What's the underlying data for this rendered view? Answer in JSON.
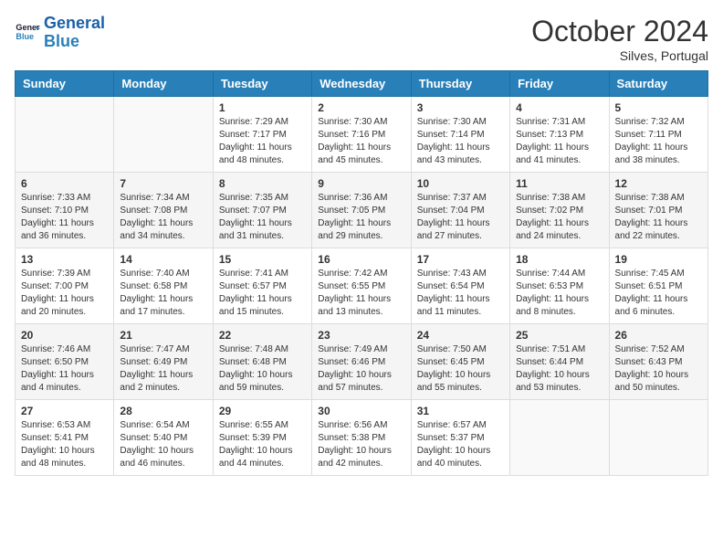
{
  "logo": {
    "line1": "General",
    "line2": "Blue"
  },
  "title": "October 2024",
  "location": "Silves, Portugal",
  "days_header": [
    "Sunday",
    "Monday",
    "Tuesday",
    "Wednesday",
    "Thursday",
    "Friday",
    "Saturday"
  ],
  "weeks": [
    [
      {
        "num": "",
        "info": ""
      },
      {
        "num": "",
        "info": ""
      },
      {
        "num": "1",
        "info": "Sunrise: 7:29 AM\nSunset: 7:17 PM\nDaylight: 11 hours and 48 minutes."
      },
      {
        "num": "2",
        "info": "Sunrise: 7:30 AM\nSunset: 7:16 PM\nDaylight: 11 hours and 45 minutes."
      },
      {
        "num": "3",
        "info": "Sunrise: 7:30 AM\nSunset: 7:14 PM\nDaylight: 11 hours and 43 minutes."
      },
      {
        "num": "4",
        "info": "Sunrise: 7:31 AM\nSunset: 7:13 PM\nDaylight: 11 hours and 41 minutes."
      },
      {
        "num": "5",
        "info": "Sunrise: 7:32 AM\nSunset: 7:11 PM\nDaylight: 11 hours and 38 minutes."
      }
    ],
    [
      {
        "num": "6",
        "info": "Sunrise: 7:33 AM\nSunset: 7:10 PM\nDaylight: 11 hours and 36 minutes."
      },
      {
        "num": "7",
        "info": "Sunrise: 7:34 AM\nSunset: 7:08 PM\nDaylight: 11 hours and 34 minutes."
      },
      {
        "num": "8",
        "info": "Sunrise: 7:35 AM\nSunset: 7:07 PM\nDaylight: 11 hours and 31 minutes."
      },
      {
        "num": "9",
        "info": "Sunrise: 7:36 AM\nSunset: 7:05 PM\nDaylight: 11 hours and 29 minutes."
      },
      {
        "num": "10",
        "info": "Sunrise: 7:37 AM\nSunset: 7:04 PM\nDaylight: 11 hours and 27 minutes."
      },
      {
        "num": "11",
        "info": "Sunrise: 7:38 AM\nSunset: 7:02 PM\nDaylight: 11 hours and 24 minutes."
      },
      {
        "num": "12",
        "info": "Sunrise: 7:38 AM\nSunset: 7:01 PM\nDaylight: 11 hours and 22 minutes."
      }
    ],
    [
      {
        "num": "13",
        "info": "Sunrise: 7:39 AM\nSunset: 7:00 PM\nDaylight: 11 hours and 20 minutes."
      },
      {
        "num": "14",
        "info": "Sunrise: 7:40 AM\nSunset: 6:58 PM\nDaylight: 11 hours and 17 minutes."
      },
      {
        "num": "15",
        "info": "Sunrise: 7:41 AM\nSunset: 6:57 PM\nDaylight: 11 hours and 15 minutes."
      },
      {
        "num": "16",
        "info": "Sunrise: 7:42 AM\nSunset: 6:55 PM\nDaylight: 11 hours and 13 minutes."
      },
      {
        "num": "17",
        "info": "Sunrise: 7:43 AM\nSunset: 6:54 PM\nDaylight: 11 hours and 11 minutes."
      },
      {
        "num": "18",
        "info": "Sunrise: 7:44 AM\nSunset: 6:53 PM\nDaylight: 11 hours and 8 minutes."
      },
      {
        "num": "19",
        "info": "Sunrise: 7:45 AM\nSunset: 6:51 PM\nDaylight: 11 hours and 6 minutes."
      }
    ],
    [
      {
        "num": "20",
        "info": "Sunrise: 7:46 AM\nSunset: 6:50 PM\nDaylight: 11 hours and 4 minutes."
      },
      {
        "num": "21",
        "info": "Sunrise: 7:47 AM\nSunset: 6:49 PM\nDaylight: 11 hours and 2 minutes."
      },
      {
        "num": "22",
        "info": "Sunrise: 7:48 AM\nSunset: 6:48 PM\nDaylight: 10 hours and 59 minutes."
      },
      {
        "num": "23",
        "info": "Sunrise: 7:49 AM\nSunset: 6:46 PM\nDaylight: 10 hours and 57 minutes."
      },
      {
        "num": "24",
        "info": "Sunrise: 7:50 AM\nSunset: 6:45 PM\nDaylight: 10 hours and 55 minutes."
      },
      {
        "num": "25",
        "info": "Sunrise: 7:51 AM\nSunset: 6:44 PM\nDaylight: 10 hours and 53 minutes."
      },
      {
        "num": "26",
        "info": "Sunrise: 7:52 AM\nSunset: 6:43 PM\nDaylight: 10 hours and 50 minutes."
      }
    ],
    [
      {
        "num": "27",
        "info": "Sunrise: 6:53 AM\nSunset: 5:41 PM\nDaylight: 10 hours and 48 minutes."
      },
      {
        "num": "28",
        "info": "Sunrise: 6:54 AM\nSunset: 5:40 PM\nDaylight: 10 hours and 46 minutes."
      },
      {
        "num": "29",
        "info": "Sunrise: 6:55 AM\nSunset: 5:39 PM\nDaylight: 10 hours and 44 minutes."
      },
      {
        "num": "30",
        "info": "Sunrise: 6:56 AM\nSunset: 5:38 PM\nDaylight: 10 hours and 42 minutes."
      },
      {
        "num": "31",
        "info": "Sunrise: 6:57 AM\nSunset: 5:37 PM\nDaylight: 10 hours and 40 minutes."
      },
      {
        "num": "",
        "info": ""
      },
      {
        "num": "",
        "info": ""
      }
    ]
  ]
}
